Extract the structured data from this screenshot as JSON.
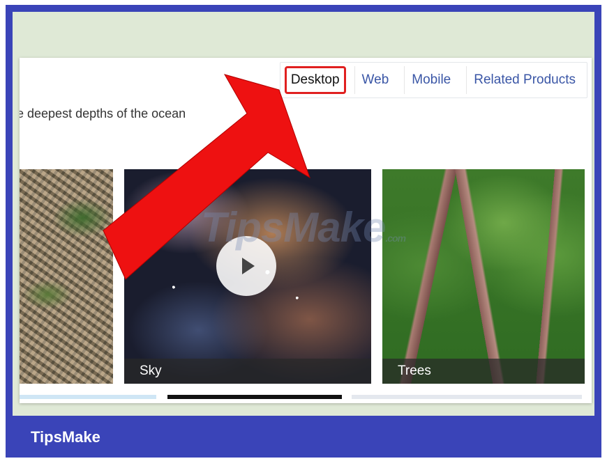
{
  "tabs": [
    {
      "label": "Desktop",
      "active": true
    },
    {
      "label": "Web",
      "active": false
    },
    {
      "label": "Mobile",
      "active": false
    },
    {
      "label": "Related Products",
      "active": false
    }
  ],
  "tagline": "e deepest depths of the ocean",
  "tiles": [
    {
      "caption": ""
    },
    {
      "caption": "Sky"
    },
    {
      "caption": "Trees"
    }
  ],
  "watermark": {
    "text": "TipsMake",
    "suffix": ".com"
  },
  "footer": {
    "brand": "TipsMake"
  },
  "icons": {
    "play": "play-icon",
    "arrow": "red-arrow-icon"
  },
  "colors": {
    "frame": "#3a44b8",
    "backdrop": "#dfe9d6",
    "highlight": "#e02020",
    "link": "#3a56a6"
  }
}
